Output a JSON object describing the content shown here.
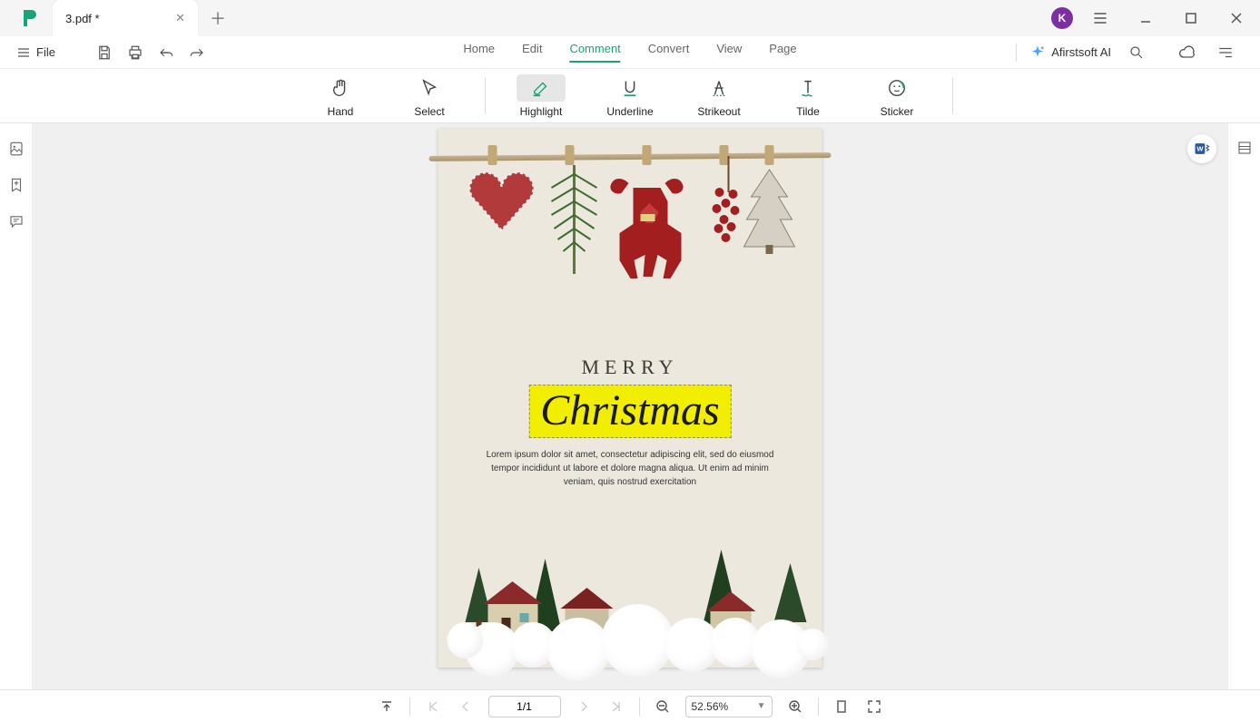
{
  "titlebar": {
    "tab_title": "3.pdf *",
    "avatar_initial": "K"
  },
  "menubar": {
    "file": "File",
    "tabs": [
      "Home",
      "Edit",
      "Comment",
      "Convert",
      "View",
      "Page"
    ],
    "active_tab": "Comment",
    "ai": "Afirstsoft AI"
  },
  "toolbar": {
    "hand": "Hand",
    "select": "Select",
    "highlight": "Highlight",
    "underline": "Underline",
    "strikeout": "Strikeout",
    "tilde": "Tilde",
    "sticker": "Sticker"
  },
  "document": {
    "merry": "MERRY",
    "christmas": "Christmas",
    "lorem": "Lorem ipsum dolor sit amet, consectetur adipiscing elit, sed do eiusmod tempor incididunt ut labore et dolore magna aliqua. Ut enim ad minim veniam, quis nostrud exercitation"
  },
  "statusbar": {
    "page": "1/1",
    "zoom": "52.56%"
  }
}
